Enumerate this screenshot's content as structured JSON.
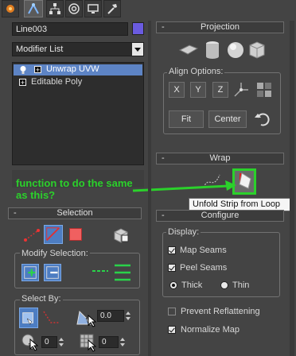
{
  "tabs": [
    {
      "icon": "create-icon"
    },
    {
      "icon": "modify-icon"
    },
    {
      "icon": "hierarchy-icon"
    },
    {
      "icon": "motion-icon"
    },
    {
      "icon": "display-icon"
    },
    {
      "icon": "utilities-icon"
    }
  ],
  "object_name": "Line003",
  "object_color": "#6a5be0",
  "modifier_list": "Modifier List",
  "stack": [
    {
      "label": "Unwrap UVW",
      "selected": true
    },
    {
      "label": "Editable Poly",
      "selected": false
    }
  ],
  "annotation": {
    "text": "function to do the same as this?",
    "color": "#2bd12b"
  },
  "selection": {
    "title": "Selection",
    "modify_label": "Modify Selection:",
    "select_by_label": "Select By:",
    "spin1": "0.0",
    "spin2": "0",
    "spin3": "0"
  },
  "projection": {
    "title": "Projection",
    "align_label": "Align Options:",
    "axes": [
      "X",
      "Y",
      "Z"
    ],
    "fit": "Fit",
    "center": "Center"
  },
  "wrap": {
    "title": "Wrap",
    "tooltip": "Unfold Strip from Loop"
  },
  "configure": {
    "title": "Configure",
    "display_label": "Display:",
    "map_seams": "Map Seams",
    "peel_seams": "Peel Seams",
    "thick": "Thick",
    "thin": "Thin",
    "prevent": "Prevent Reflattening",
    "normalize": "Normalize Map"
  }
}
